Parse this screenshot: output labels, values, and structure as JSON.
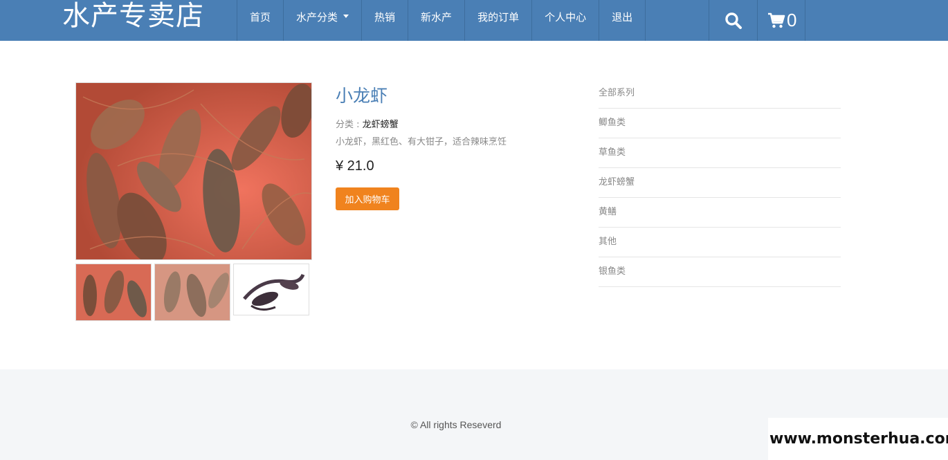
{
  "brand": {
    "name": "水产专卖店"
  },
  "nav": {
    "items": [
      {
        "label": "首页"
      },
      {
        "label": "水产分类"
      },
      {
        "label": "热销"
      },
      {
        "label": "新水产"
      },
      {
        "label": "我的订单"
      },
      {
        "label": "个人中心"
      },
      {
        "label": "退出"
      }
    ],
    "search_icon": "search-icon",
    "cart_icon": "cart-icon",
    "cart_count": "0"
  },
  "product": {
    "title": "小龙虾",
    "category_label": "分类 : ",
    "category_value": "龙虾螃蟹",
    "description": "小龙虾，黑红色、有大钳子，适合辣味烹饪",
    "price": "¥ 21.0",
    "add_to_cart": "加入购物车",
    "thumbnail_count": 3
  },
  "categories": [
    {
      "label": "全部系列"
    },
    {
      "label": "鲫鱼类"
    },
    {
      "label": "草鱼类"
    },
    {
      "label": "龙虾螃蟹"
    },
    {
      "label": "黄鳝"
    },
    {
      "label": "其他"
    },
    {
      "label": "银鱼类"
    }
  ],
  "footer": {
    "copyright": "© All rights Reseverd"
  },
  "watermark": {
    "text": "www.monsterhua.com"
  },
  "colors": {
    "navbar": "#4a7fb5",
    "accent": "#f0831e",
    "title": "#4a7fb5",
    "footer_bg": "#f4f6f8"
  }
}
